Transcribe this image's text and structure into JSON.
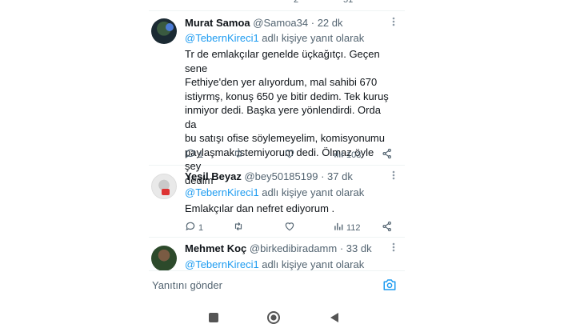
{
  "top_strip": {
    "left_count": "2",
    "right_count": "51"
  },
  "tweets": [
    {
      "name": "Murat Samoa",
      "handle": "@Samoa34",
      "time": "· 22 dk",
      "reply_mention": "@TebernKireci1",
      "reply_suffix": " adlı kişiye yanıt olarak",
      "text_lines": [
        "Tr de emlakçılar genelde üçkağıtçı. Geçen sene",
        "Fethiye'den yer alıyordum, mal sahibi 670",
        "istiyrmş, konuş 650 ye bitir dedim. Tek kuruş",
        "inmiyor dedi. Başka yere yönlendirdi. Orda da",
        "bu satışı ofise söylemeyelim, komisyonumu",
        "paylaşmak istemiyorum dedi. Ölmaz öyle şey",
        "dedim"
      ],
      "replies": "1",
      "views": "103"
    },
    {
      "name": "Yeşil Beyaz",
      "handle": "@bey50185199",
      "time": "· 37 dk",
      "reply_mention": "@TebernKireci1",
      "reply_suffix": " adlı kişiye yanıt olarak",
      "text_lines": [
        "Emlakçılar dan nefret ediyorum ."
      ],
      "replies": "1",
      "views": "112"
    },
    {
      "name": "Mehmet Koç",
      "handle": "@birkedibiradamm",
      "time": "· 33 dk",
      "reply_mention": "@TebernKireci1",
      "reply_suffix": " adlı kişiye yanıt olarak"
    }
  ],
  "composer": {
    "placeholder": "Yanıtını gönder"
  },
  "icons": {
    "more": "more-dots-icon",
    "reply": "reply-icon",
    "retweet": "retweet-icon",
    "like": "like-icon",
    "views": "views-icon",
    "share": "share-icon",
    "camera": "camera-icon",
    "recents": "recents-square-icon",
    "home": "home-circle-icon",
    "back": "back-triangle-icon"
  },
  "colors": {
    "accent": "#1d9bf0",
    "muted": "#536471",
    "text": "#0f1419"
  }
}
